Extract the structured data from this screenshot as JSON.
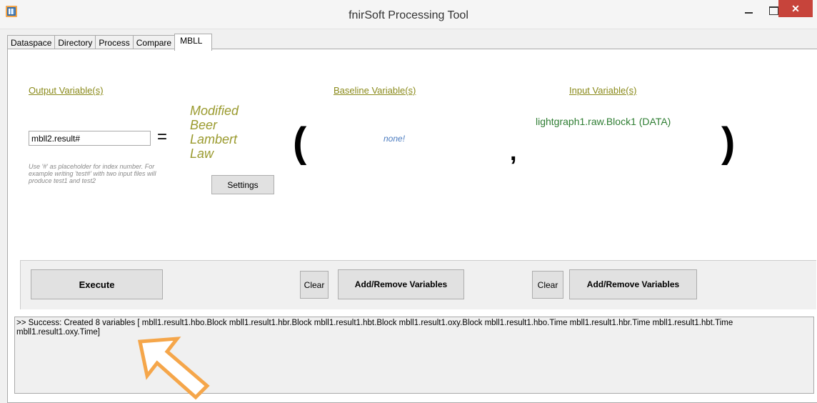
{
  "window": {
    "title": "fnirSoft Processing Tool"
  },
  "tabs": [
    "Dataspace",
    "Directory",
    "Process",
    "Compare",
    "MBLL"
  ],
  "output": {
    "header": "Output Variable(s)",
    "value": "mbll2.result#",
    "equals": "=",
    "hint": "Use '#' as placeholder for index number. For example writing 'test#' with two input files will produce test1 and test2"
  },
  "method": {
    "line1": "Modified",
    "line2": "Beer",
    "line3": "Lambert",
    "line4": "Law",
    "settings_label": "Settings"
  },
  "baseline": {
    "header": "Baseline Variable(s)",
    "value": "none!"
  },
  "input": {
    "header": "Input Variable(s)",
    "value": "lightgraph1.raw.Block1 (DATA)"
  },
  "symbols": {
    "open_paren": "(",
    "comma": ",",
    "close_paren": ")"
  },
  "actions": {
    "execute_label": "Execute",
    "clear_baseline_label": "Clear",
    "add_remove_baseline_label": "Add/Remove Variables",
    "clear_input_label": "Clear",
    "add_remove_input_label": "Add/Remove Variables"
  },
  "log": {
    "text": ">> Success: Created 8 variables [ mbll1.result1.hbo.Block mbll1.result1.hbr.Block mbll1.result1.hbt.Block mbll1.result1.oxy.Block mbll1.result1.hbo.Time mbll1.result1.hbr.Time mbll1.result1.hbt.Time mbll1.result1.oxy.Time]"
  },
  "colors": {
    "header_olive": "#8a8a1a",
    "input_green": "#2e7d32",
    "none_blue": "#4b7bbf",
    "arrow_orange": "#f5a64a",
    "close_red": "#c7443b"
  }
}
